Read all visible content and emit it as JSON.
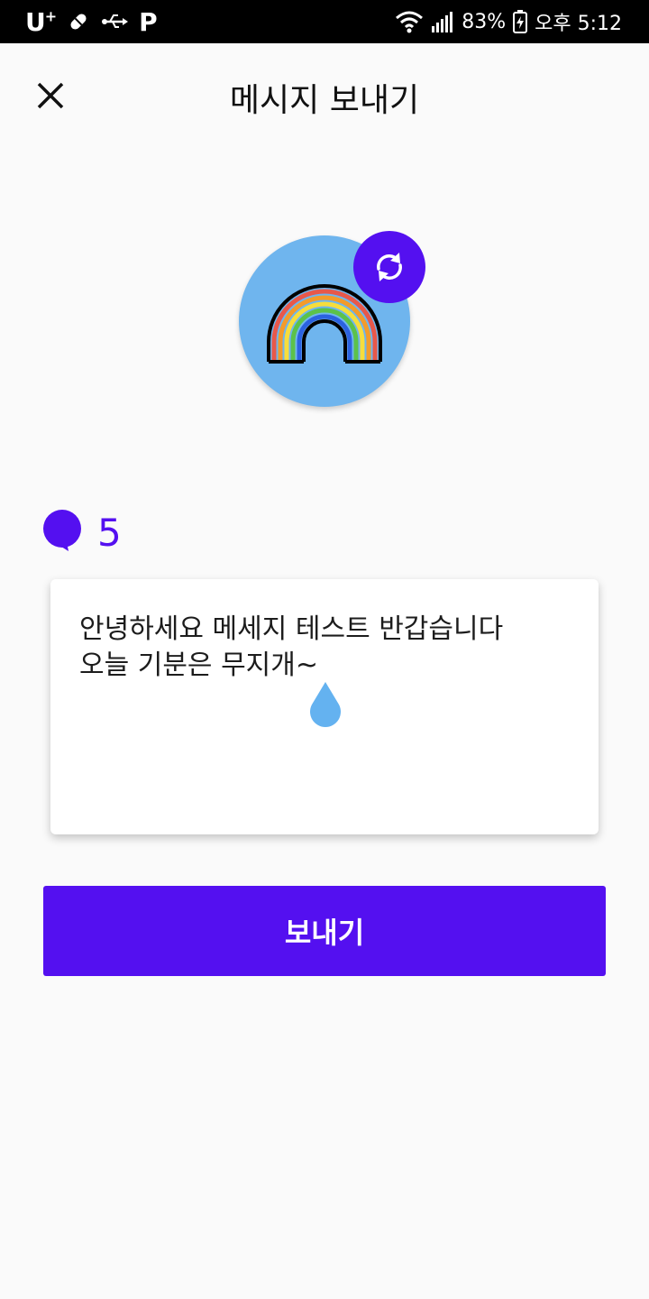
{
  "status_bar": {
    "carrier": "U",
    "carrier_sup": "+",
    "parking_label": "P",
    "battery": "83%",
    "time": "오후 5:12",
    "icons": [
      "pill-icon",
      "usb-icon",
      "wifi-icon",
      "signal-icon",
      "battery-charging-icon"
    ]
  },
  "header": {
    "title": "메시지 보내기",
    "close_icon": "close-icon"
  },
  "avatar": {
    "icon": "rainbow-icon",
    "background": "#6fb5ee",
    "refresh_icon": "refresh-icon"
  },
  "message_count": {
    "icon": "speech-bubble-icon",
    "value": "5"
  },
  "message": {
    "text": "안녕하세요 메세지 테스트 반갑습니다\n오늘 기분은 무지개~"
  },
  "send_button": {
    "label": "보내기"
  },
  "colors": {
    "accent": "#5410f0",
    "background": "#fafafa",
    "avatar_bg": "#6fb5ee"
  }
}
